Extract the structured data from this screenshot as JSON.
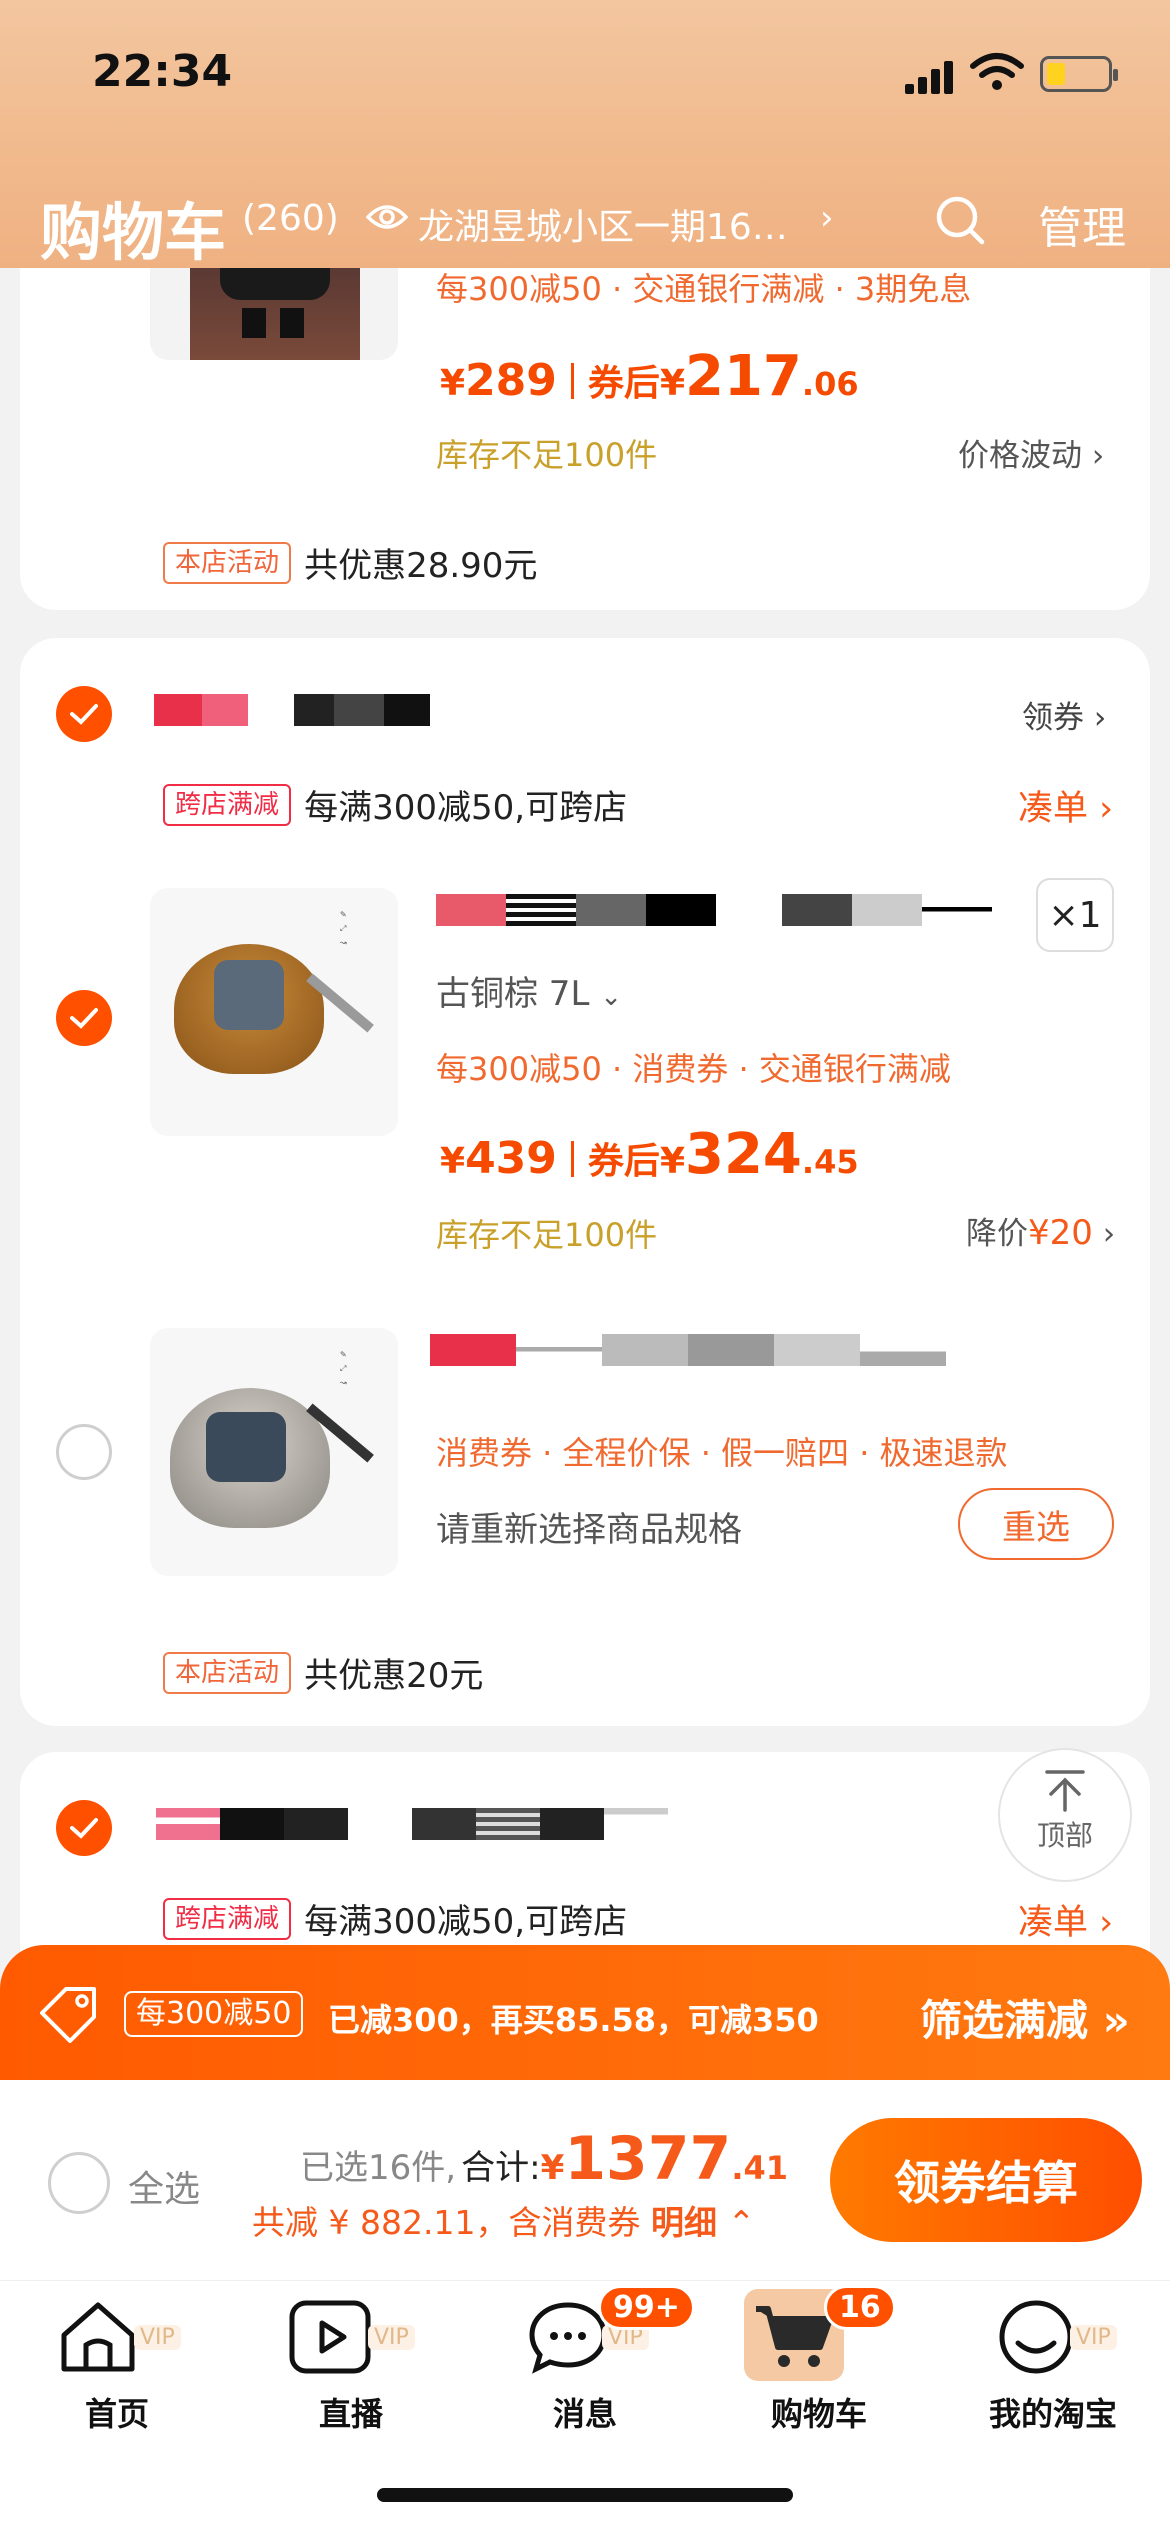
{
  "status_bar": {
    "time": "22:34"
  },
  "header": {
    "title": "购物车",
    "count": "(260)",
    "location": "龙湖昱城小区一期16…",
    "location_arrow": "›",
    "manage": "管理"
  },
  "card1": {
    "promo_line": "每300减50 · 交通银行满减 · 3期免息",
    "price_symbol": "¥",
    "price": "289",
    "after_label": "券后",
    "after_symbol": "¥",
    "after_int": "217",
    "after_dec": ".06",
    "stock": "库存不足100件",
    "price_note": "价格波动",
    "shop_tag": "本店活动",
    "shop_discount": "共优惠28.90元"
  },
  "card2": {
    "coupon": "领券",
    "cross_tag": "跨店满减",
    "cross_text": "每满300减50,可跨店",
    "combine": "凑单",
    "item1": {
      "sku": "古铜棕 7L",
      "qty": "×1",
      "promo_line": "每300减50 · 消费券 · 交通银行满减",
      "price_symbol": "¥",
      "price": "439",
      "after_label": "券后",
      "after_symbol": "¥",
      "after_int": "324",
      "after_dec": ".45",
      "stock": "库存不足100件",
      "drop_label": "降价",
      "drop_value": "¥20"
    },
    "item2": {
      "promo_line": "消费券 · 全程价保 · 假一赔四 · 极速退款",
      "reselect_hint": "请重新选择商品规格",
      "reselect_button": "重选"
    },
    "shop_tag": "本店活动",
    "shop_discount": "共优惠20元"
  },
  "card3": {
    "cross_tag": "跨店满减",
    "cross_text": "每满300减50,可跨店",
    "combine": "凑单"
  },
  "top_button": {
    "label": "顶部"
  },
  "promo_bar": {
    "tag": "每300减50",
    "text": "已减300，再买85.58，可减350",
    "action": "筛选满减"
  },
  "checkout": {
    "select_all": "全选",
    "selected": "已选16件,",
    "total_label": "合计:",
    "total_symbol": "¥",
    "total_int": "1377",
    "total_dec": ".41",
    "saving": "共减 ¥ 882.11，含消费券",
    "detail": "明细",
    "button": "领券结算"
  },
  "tabs": [
    {
      "label": "首页",
      "vip": "VIP"
    },
    {
      "label": "直播",
      "vip": "VIP"
    },
    {
      "label": "消息",
      "vip": "VIP",
      "badge": "99+"
    },
    {
      "label": "购物车",
      "badge": "16"
    },
    {
      "label": "我的淘宝",
      "vip": "VIP"
    }
  ],
  "colors": {
    "accent": "#ff5000",
    "price": "#f54a00",
    "stock": "#c9a02a",
    "header": "#f1b98c"
  }
}
